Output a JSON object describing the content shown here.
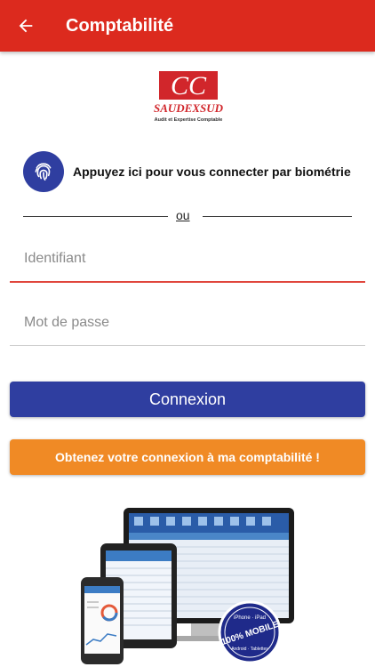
{
  "appbar": {
    "title": "Comptabilité",
    "back_icon": "arrow-left-icon",
    "color": "#dc2a1e"
  },
  "logo": {
    "brand": "SAUDEXSUD",
    "tagline": "Audit et Expertise Comptable",
    "mark": "CC"
  },
  "biometric": {
    "icon": "fingerprint-icon",
    "label": "Appuyez ici pour vous connecter par biométrie"
  },
  "divider": {
    "text": "ou"
  },
  "form": {
    "identifiant_placeholder": "Identifiant",
    "identifiant_value": "",
    "password_placeholder": "Mot de passe",
    "password_value": ""
  },
  "buttons": {
    "connect_label": "Connexion",
    "connect_color": "#2f3ea0",
    "get_access_label": "Obtenez votre connexion à ma comptabilité !",
    "get_access_color": "#f08a25"
  },
  "promo": {
    "badge_top": "iPhone · iPad",
    "badge_main": "100% MOBILE",
    "badge_bottom": "Android · Tablettes"
  }
}
